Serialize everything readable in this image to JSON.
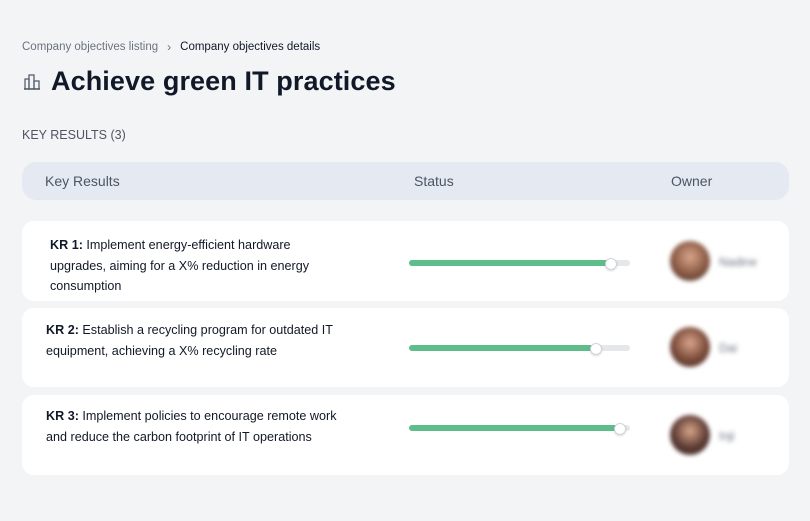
{
  "breadcrumb": {
    "parent": "Company objectives listing",
    "separator": "›",
    "current": "Company objectives details"
  },
  "page": {
    "icon": "building-icon",
    "title": "Achieve green IT practices"
  },
  "section": {
    "label": "KEY RESULTS (3)"
  },
  "table": {
    "headers": {
      "key_results": "Key Results",
      "status": "Status",
      "owner": "Owner"
    },
    "rows": [
      {
        "code": "KR 1:",
        "text": " Implement energy-efficient hardware upgrades, aiming for a X% reduction in energy consumption",
        "progress": 0.91,
        "owner": "Nadine",
        "avatar_color": "#8a5a44"
      },
      {
        "code": "KR 2:",
        "text": " Establish a recycling program for outdated IT equipment, achieving a X% recycling rate",
        "progress": 0.84,
        "owner": "Dai",
        "avatar_color": "#7a4a3a"
      },
      {
        "code": "KR 3:",
        "text": " Implement policies to encourage remote work and reduce the carbon footprint of IT operations",
        "progress": 0.95,
        "owner": "Inji",
        "avatar_color": "#5b3a33"
      }
    ]
  },
  "colors": {
    "progress_fill": "#5ebd8a",
    "progress_track": "#e5e7eb",
    "header_bg": "#e5e9f2",
    "page_bg": "#f3f4f6"
  }
}
